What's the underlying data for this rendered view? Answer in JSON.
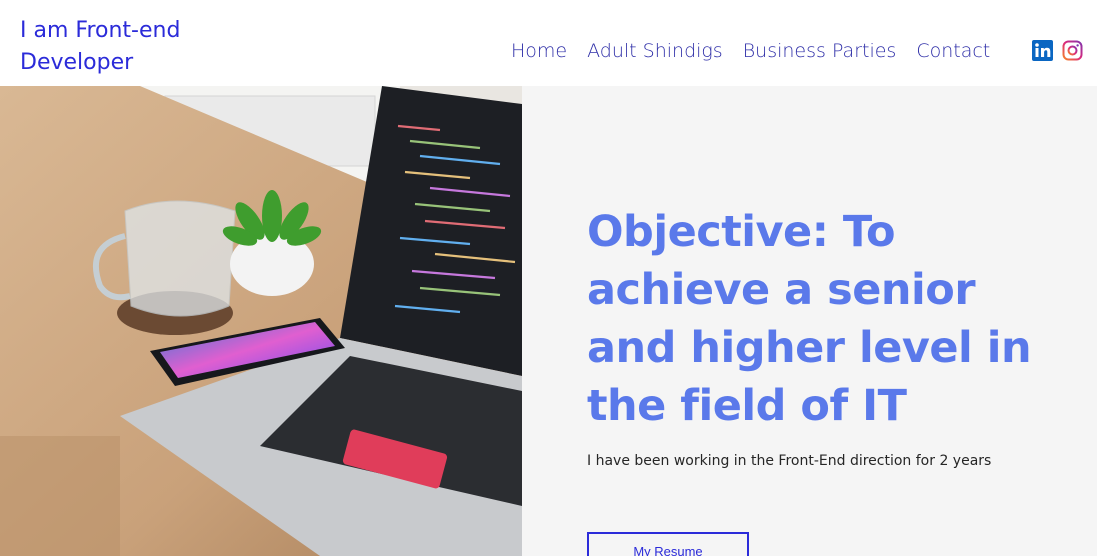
{
  "header": {
    "site_title_line1": "I am Front-end",
    "site_title_line2": "Developer",
    "nav": [
      "Home",
      "Adult Shindigs",
      "Business Parties",
      "Contact"
    ],
    "social": [
      {
        "icon": "linkedin-icon",
        "color": "#0a66c2"
      },
      {
        "icon": "instagram-icon",
        "color": "#d6249f"
      }
    ]
  },
  "hero": {
    "headline": "Objective: To achieve a senior and higher level in the field of IT",
    "subline": "I have been working in the Front-End direction for 2 years",
    "resume_button": "My Resume",
    "image": "laptop-desk-photo"
  },
  "colors": {
    "brand": "#2b2bd9",
    "headline": "#5a79ea",
    "panel_background": "#f5f5f5"
  }
}
